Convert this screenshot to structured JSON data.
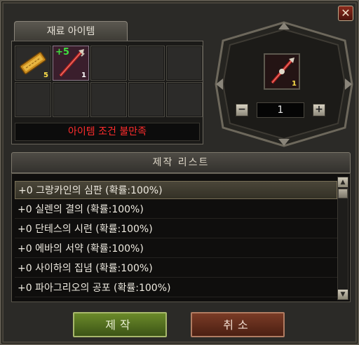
{
  "window": {
    "close_symbol": "✕"
  },
  "materials": {
    "tab_label": "재료 아이템",
    "slots": [
      {
        "icon": "golden-scroll-icon",
        "count": "5",
        "count_color": "#ffe14a"
      },
      {
        "icon": "red-staff-icon",
        "enhance": "+5",
        "count": "1",
        "count_color": "#ffffff"
      }
    ],
    "empty_slots": 8,
    "status": "아이템 조건 불만족"
  },
  "result": {
    "icon": "red-staff-icon",
    "count": "1",
    "quantity": "1",
    "minus_label": "−",
    "plus_label": "+"
  },
  "craft_list": {
    "header": "제작 리스트",
    "items": [
      "+0 그랑카인의 심판 (확률:100%)",
      "+0 실렌의 결의 (확률:100%)",
      "+0 단테스의 시련 (확률:100%)",
      "+0 에바의 서약 (확률:100%)",
      "+0 사이하의 집념 (확률:100%)",
      "+0 파아그리오의 공포 (확률:100%)"
    ],
    "selected_index": 0,
    "scroll_up": "▲",
    "scroll_down": "▼"
  },
  "buttons": {
    "craft": "제작",
    "cancel": "취소"
  },
  "colors": {
    "status_text": "#ff2d2d",
    "enhance_text": "#40e040",
    "craft_button": "#5a7a22",
    "cancel_button": "#6a3020"
  }
}
